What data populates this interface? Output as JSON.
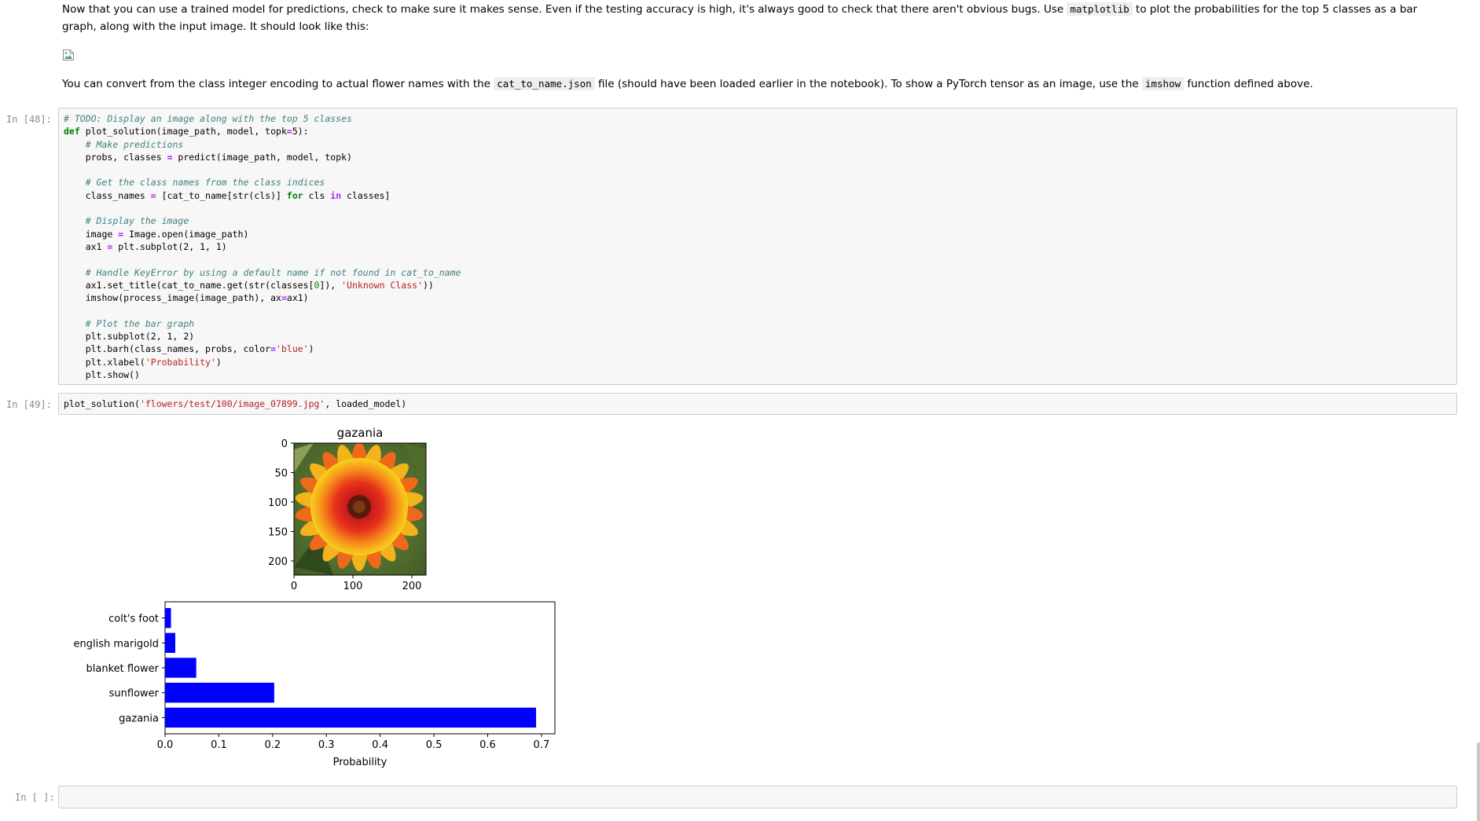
{
  "markdown": {
    "intro_prefix": "Now that you can use a trained model for predictions, check to make sure it makes sense. Even if the testing accuracy is high, it's always good to check that there aren't obvious bugs. Use",
    "intro_code": "matplotlib",
    "intro_suffix": "to plot the probabilities for the top 5 classes as a bar graph, along with the input image. It should look like this:",
    "convert_prefix": "You can convert from the class integer encoding to actual flower names with the",
    "convert_code": "cat_to_name.json",
    "convert_mid": "file (should have been loaded earlier in the notebook). To show a PyTorch tensor as an image, use the",
    "convert_code2": "imshow",
    "convert_suffix": "function defined above."
  },
  "cells": {
    "cell48": {
      "prompt": "In [48]:"
    },
    "cell49": {
      "prompt": "In [49]:"
    },
    "cell_empty": {
      "prompt": "In [ ]:"
    }
  },
  "icons": {
    "broken_image": "broken-image-icon"
  },
  "chart_data": [
    {
      "type": "image",
      "title": "gazania",
      "xticks": [
        "0",
        "100",
        "200"
      ],
      "yticks": [
        "0",
        "50",
        "100",
        "150",
        "200"
      ],
      "xlim": [
        0,
        224
      ],
      "ylim": [
        224,
        0
      ]
    },
    {
      "type": "bar",
      "orientation": "horizontal",
      "categories": [
        "gazania",
        "sunflower",
        "blanket flower",
        "english marigold",
        "colt's foot"
      ],
      "values": [
        0.69,
        0.203,
        0.058,
        0.019,
        0.011
      ],
      "xlabel": "Probability",
      "ylabel": "",
      "xlim": [
        0.0,
        0.725
      ],
      "xticks": [
        "0.0",
        "0.1",
        "0.2",
        "0.3",
        "0.4",
        "0.5",
        "0.6",
        "0.7"
      ],
      "bar_color": "#0000ff"
    }
  ]
}
